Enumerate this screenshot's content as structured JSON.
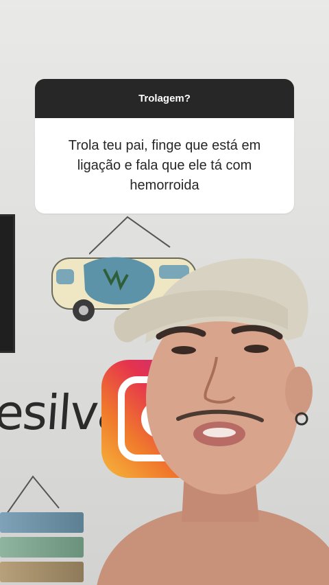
{
  "question_sticker": {
    "title": "Trolagem?",
    "answer": "Trola teu pai, finge que está em ligação e fala que ele tá com hemorroida"
  },
  "background": {
    "wall_text": "esilva"
  },
  "colors": {
    "card_header": "#272727",
    "card_body": "#ffffff",
    "card_text": "#262626",
    "wall": "#e4e4e2"
  }
}
